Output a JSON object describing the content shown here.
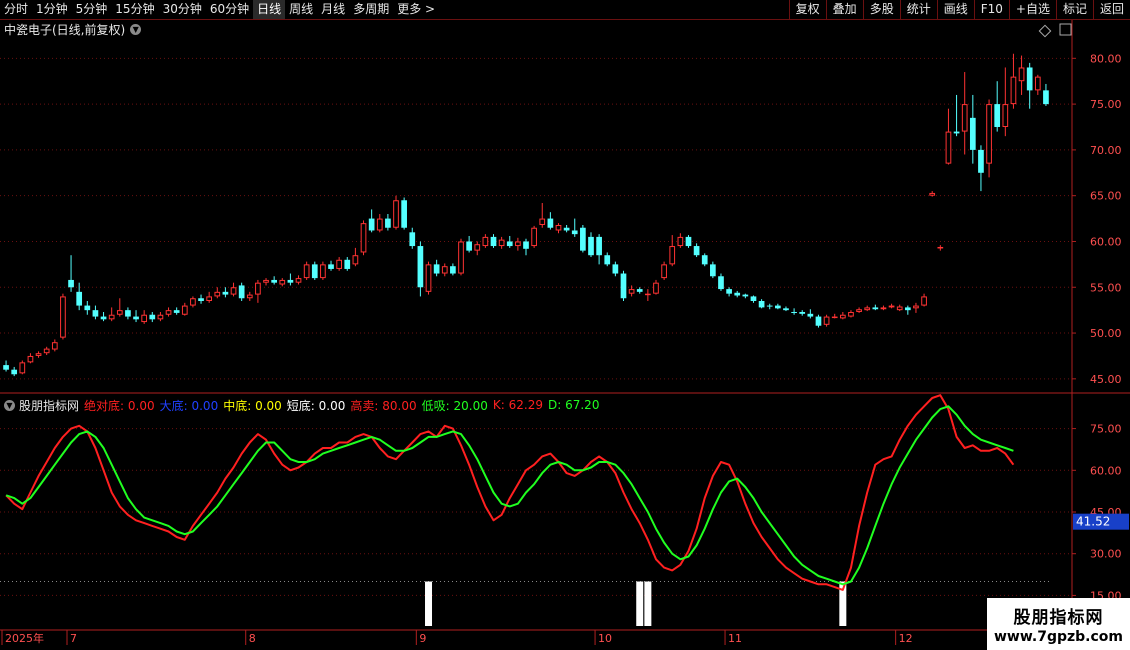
{
  "toolbar": {
    "tabs": [
      "分时",
      "1分钟",
      "5分钟",
      "15分钟",
      "30分钟",
      "60分钟",
      "日线",
      "周线",
      "月线",
      "多周期",
      "更多 >"
    ],
    "active_tab": "日线",
    "right_buttons": [
      "复权",
      "叠加",
      "多股",
      "统计",
      "画线",
      "F10",
      "+自选",
      "标记",
      "返回"
    ]
  },
  "title": "中瓷电子(日线,前复权)",
  "indicator": {
    "name": "股朋指标网",
    "legend": [
      {
        "label": "绝对底:",
        "value": "0.00",
        "color": "#ff2020"
      },
      {
        "label": "大底:",
        "value": "0.00",
        "color": "#2040ff"
      },
      {
        "label": "中底:",
        "value": "0.00",
        "color": "#ffff00"
      },
      {
        "label": "短底:",
        "value": "0.00",
        "color": "#ffffff"
      },
      {
        "label": "高卖:",
        "value": "80.00",
        "color": "#ff2020"
      },
      {
        "label": "低吸:",
        "value": "20.00",
        "color": "#20ff20"
      },
      {
        "label": "K:",
        "value": "62.29",
        "color": "#ff2020"
      },
      {
        "label": "D:",
        "value": "67.20",
        "color": "#20ff20"
      }
    ],
    "current_value": "41.52"
  },
  "watermark": {
    "line1": "股朋指标网",
    "line2": "www.7gpzb.com"
  },
  "colors": {
    "up": "#ff3333",
    "down": "#54ffff",
    "k_line": "#ff2020",
    "d_line": "#20ff20",
    "axis": "#b02020",
    "grid": "#6a1010"
  },
  "chart_data": [
    {
      "type": "candlestick",
      "title": "中瓷电子(日线,前复权)",
      "ylim": [
        44,
        82
      ],
      "y_ticks": [
        45.0,
        50.0,
        55.0,
        60.0,
        65.0,
        70.0,
        75.0,
        80.0
      ],
      "x_ticks": [
        {
          "label": "2025年",
          "index": 0
        },
        {
          "label": "7",
          "index": 8
        },
        {
          "label": "8",
          "index": 30
        },
        {
          "label": "9",
          "index": 51
        },
        {
          "label": "10",
          "index": 73
        },
        {
          "label": "11",
          "index": 89
        },
        {
          "label": "12",
          "index": 110
        }
      ],
      "candles": [
        [
          46.5,
          46.0,
          47.0,
          45.8
        ],
        [
          46.0,
          45.5,
          46.3,
          45.3
        ],
        [
          45.6,
          46.8,
          47.0,
          45.5
        ],
        [
          46.8,
          47.5,
          47.8,
          46.7
        ],
        [
          47.5,
          47.8,
          48.0,
          47.3
        ],
        [
          47.8,
          48.3,
          48.5,
          47.6
        ],
        [
          48.2,
          49.0,
          49.3,
          48.0
        ],
        [
          49.5,
          54.0,
          54.3,
          49.3
        ],
        [
          55.8,
          55.0,
          58.5,
          54.5
        ],
        [
          54.5,
          53.0,
          55.5,
          52.5
        ],
        [
          53.0,
          52.5,
          53.5,
          52.0
        ],
        [
          52.5,
          51.8,
          53.0,
          51.5
        ],
        [
          51.8,
          51.5,
          52.3,
          51.3
        ],
        [
          51.5,
          52.0,
          52.8,
          51.3
        ],
        [
          52.0,
          52.5,
          53.8,
          51.8
        ],
        [
          52.5,
          51.8,
          52.8,
          51.5
        ],
        [
          51.8,
          51.5,
          52.5,
          51.2
        ],
        [
          51.2,
          52.0,
          52.5,
          51.0
        ],
        [
          52.0,
          51.5,
          52.3,
          51.2
        ],
        [
          51.5,
          52.0,
          52.3,
          51.3
        ],
        [
          52.0,
          52.5,
          52.8,
          51.8
        ],
        [
          52.5,
          52.2,
          52.8,
          52.0
        ],
        [
          52.0,
          53.0,
          53.3,
          51.9
        ],
        [
          53.0,
          53.8,
          54.0,
          52.8
        ],
        [
          53.8,
          53.5,
          54.2,
          53.2
        ],
        [
          53.5,
          54.0,
          54.5,
          53.3
        ],
        [
          54.0,
          54.5,
          55.0,
          53.8
        ],
        [
          54.5,
          54.2,
          55.0,
          53.9
        ],
        [
          54.2,
          55.0,
          55.5,
          54.0
        ],
        [
          55.2,
          53.8,
          55.5,
          53.5
        ],
        [
          53.8,
          54.2,
          54.5,
          53.5
        ],
        [
          54.2,
          55.5,
          55.8,
          53.3
        ],
        [
          55.5,
          55.8,
          56.0,
          55.2
        ],
        [
          55.8,
          55.5,
          56.2,
          55.3
        ],
        [
          55.3,
          55.8,
          56.0,
          55.1
        ],
        [
          55.8,
          55.5,
          56.5,
          55.2
        ],
        [
          55.5,
          56.0,
          56.3,
          55.3
        ],
        [
          56.0,
          57.5,
          57.8,
          55.8
        ],
        [
          57.5,
          56.0,
          57.8,
          55.8
        ],
        [
          56.0,
          57.5,
          57.8,
          55.8
        ],
        [
          57.5,
          57.0,
          57.9,
          56.8
        ],
        [
          57.0,
          58.0,
          58.3,
          56.8
        ],
        [
          58.0,
          57.0,
          58.3,
          56.8
        ],
        [
          57.5,
          58.5,
          59.3,
          57.3
        ],
        [
          58.8,
          62.0,
          62.3,
          58.5
        ],
        [
          62.5,
          61.2,
          63.5,
          61.0
        ],
        [
          61.2,
          62.5,
          63.0,
          61.0
        ],
        [
          62.5,
          61.5,
          63.0,
          61.2
        ],
        [
          61.5,
          64.5,
          65.0,
          61.3
        ],
        [
          64.5,
          61.5,
          64.8,
          61.3
        ],
        [
          61.0,
          59.5,
          61.5,
          59.2
        ],
        [
          59.5,
          55.0,
          60.0,
          54.0
        ],
        [
          54.5,
          57.5,
          57.8,
          54.2
        ],
        [
          57.5,
          56.5,
          58.0,
          56.2
        ],
        [
          56.5,
          57.3,
          57.6,
          56.2
        ],
        [
          57.3,
          56.5,
          57.6,
          56.3
        ],
        [
          56.5,
          60.0,
          60.3,
          56.3
        ],
        [
          60.0,
          59.0,
          60.6,
          58.8
        ],
        [
          59.0,
          59.7,
          60.0,
          58.5
        ],
        [
          59.5,
          60.5,
          60.8,
          59.3
        ],
        [
          60.5,
          59.5,
          60.8,
          59.3
        ],
        [
          59.5,
          60.2,
          60.5,
          59.2
        ],
        [
          60.0,
          59.5,
          60.6,
          59.3
        ],
        [
          59.5,
          60.0,
          60.4,
          59.0
        ],
        [
          60.0,
          59.2,
          60.3,
          58.5
        ],
        [
          59.5,
          61.5,
          61.7,
          59.3
        ],
        [
          61.8,
          62.5,
          64.2,
          61.5
        ],
        [
          62.5,
          61.5,
          63.2,
          61.3
        ],
        [
          61.2,
          61.8,
          62.0,
          60.9
        ],
        [
          61.5,
          61.2,
          61.8,
          61.0
        ],
        [
          61.2,
          60.8,
          62.5,
          60.5
        ],
        [
          61.5,
          59.0,
          61.8,
          58.8
        ],
        [
          60.5,
          58.5,
          61.0,
          58.3
        ],
        [
          60.5,
          58.5,
          60.8,
          57.5
        ],
        [
          58.5,
          57.5,
          58.8,
          57.3
        ],
        [
          57.5,
          56.5,
          57.8,
          56.2
        ],
        [
          56.5,
          53.8,
          56.8,
          53.5
        ],
        [
          54.3,
          54.8,
          55.2,
          54.0
        ],
        [
          54.8,
          54.5,
          55.0,
          54.3
        ],
        [
          54.3,
          54.3,
          54.8,
          53.5
        ],
        [
          54.3,
          55.5,
          55.8,
          54.2
        ],
        [
          56.0,
          57.5,
          57.8,
          55.8
        ],
        [
          57.5,
          59.5,
          60.7,
          57.3
        ],
        [
          59.5,
          60.5,
          60.9,
          59.3
        ],
        [
          60.5,
          59.5,
          60.7,
          59.3
        ],
        [
          59.5,
          58.5,
          59.8,
          58.3
        ],
        [
          58.5,
          57.5,
          58.7,
          57.3
        ],
        [
          57.5,
          56.2,
          57.8,
          56.0
        ],
        [
          56.2,
          54.8,
          56.5,
          54.6
        ],
        [
          54.8,
          54.3,
          55.0,
          54.0
        ],
        [
          54.4,
          54.1,
          54.6,
          53.9
        ],
        [
          54.2,
          54.0,
          54.3,
          53.8
        ],
        [
          54.0,
          53.5,
          54.1,
          53.3
        ],
        [
          53.5,
          52.8,
          53.7,
          52.7
        ],
        [
          53.0,
          52.9,
          53.2,
          52.6
        ],
        [
          53.0,
          52.7,
          53.2,
          52.6
        ],
        [
          52.7,
          52.5,
          52.9,
          52.4
        ],
        [
          52.3,
          52.2,
          52.7,
          52.0
        ],
        [
          52.3,
          52.1,
          52.5,
          51.9
        ],
        [
          52.1,
          51.8,
          52.6,
          51.6
        ],
        [
          51.8,
          50.8,
          52.0,
          50.6
        ],
        [
          50.9,
          51.8,
          52.0,
          50.7
        ],
        [
          51.7,
          51.8,
          52.1,
          51.6
        ],
        [
          51.6,
          52.0,
          52.3,
          51.5
        ],
        [
          51.8,
          52.3,
          52.5,
          51.7
        ],
        [
          52.3,
          52.6,
          52.8,
          52.2
        ],
        [
          52.5,
          52.8,
          53.0,
          52.4
        ],
        [
          52.8,
          52.6,
          53.1,
          52.5
        ],
        [
          52.6,
          52.8,
          53.0,
          52.5
        ],
        [
          52.8,
          53.0,
          53.2,
          52.7
        ],
        [
          52.5,
          52.9,
          53.1,
          52.4
        ],
        [
          52.8,
          52.5,
          53.0,
          52.0
        ],
        [
          52.7,
          53.0,
          53.3,
          52.2
        ],
        [
          53.0,
          54.0,
          54.3,
          52.9
        ],
        [
          65.0,
          65.3,
          65.5,
          64.9
        ],
        [
          59.3,
          59.4,
          59.6,
          59.0
        ],
        [
          68.5,
          72.0,
          74.5,
          68.4
        ],
        [
          72.0,
          71.8,
          76.0,
          71.5
        ],
        [
          72.0,
          75.0,
          78.5,
          69.5
        ],
        [
          73.5,
          70.0,
          76.0,
          68.5
        ],
        [
          70.0,
          67.5,
          70.5,
          65.5
        ],
        [
          68.5,
          75.0,
          75.5,
          67.0
        ],
        [
          75.0,
          72.5,
          77.5,
          72.0
        ],
        [
          72.5,
          75.0,
          79.0,
          71.5
        ],
        [
          75.0,
          78.0,
          80.5,
          74.5
        ],
        [
          77.5,
          79.0,
          80.3,
          76.0
        ],
        [
          79.0,
          76.5,
          79.5,
          74.5
        ],
        [
          76.5,
          78.0,
          78.2,
          76.0
        ],
        [
          76.5,
          75.0,
          77.2,
          74.8
        ]
      ]
    },
    {
      "type": "line",
      "title": "股朋指标网",
      "ylim": [
        4,
        86
      ],
      "y_ticks": [
        15.0,
        30.0,
        45.0,
        60.0,
        75.0
      ],
      "reference_lines": {
        "high_sell": 80.0,
        "low_buy": 20.0
      },
      "series": [
        {
          "name": "K",
          "values": [
            51,
            48,
            46,
            52,
            58,
            63,
            68,
            72,
            75,
            76,
            74,
            68,
            60,
            52,
            47,
            44,
            42,
            41,
            40,
            39,
            38,
            36,
            35,
            40,
            44,
            48,
            52,
            57,
            61,
            66,
            70,
            73,
            71,
            66,
            62,
            60,
            61,
            63,
            66,
            68,
            68,
            70,
            70,
            72,
            73,
            72,
            68,
            65,
            64,
            67,
            70,
            73,
            74,
            72,
            76,
            75,
            69,
            62,
            54,
            47,
            42,
            44,
            50,
            55,
            60,
            62,
            65,
            66,
            63,
            59,
            58,
            60,
            63,
            65,
            63,
            59,
            52,
            46,
            41,
            35,
            28,
            25,
            24,
            26,
            31,
            39,
            50,
            58,
            63,
            62,
            56,
            48,
            41,
            36,
            32,
            28,
            25,
            23,
            21,
            20,
            19,
            19,
            18,
            17,
            25,
            40,
            52,
            62,
            64,
            65,
            71,
            76,
            80,
            83,
            86,
            87,
            82,
            72,
            68,
            69,
            67,
            67,
            68,
            66,
            62
          ]
        },
        {
          "name": "D",
          "values": [
            51,
            50,
            48,
            50,
            54,
            58,
            62,
            66,
            70,
            73,
            74,
            72,
            68,
            62,
            56,
            50,
            46,
            43,
            42,
            41,
            40,
            38,
            37,
            38,
            41,
            44,
            47,
            51,
            55,
            59,
            63,
            67,
            70,
            70,
            67,
            64,
            63,
            63,
            64,
            66,
            67,
            68,
            69,
            70,
            71,
            72,
            71,
            69,
            67,
            67,
            68,
            70,
            72,
            72,
            73,
            74,
            73,
            69,
            64,
            58,
            52,
            48,
            47,
            48,
            52,
            55,
            59,
            62,
            63,
            62,
            60,
            60,
            61,
            63,
            63,
            62,
            59,
            55,
            50,
            45,
            39,
            34,
            30,
            28,
            29,
            33,
            39,
            46,
            52,
            56,
            57,
            54,
            50,
            45,
            41,
            37,
            33,
            29,
            26,
            24,
            22,
            21,
            20,
            19,
            20,
            25,
            32,
            40,
            48,
            55,
            61,
            66,
            71,
            75,
            79,
            82,
            83,
            80,
            76,
            73,
            71,
            70,
            69,
            68,
            67
          ]
        },
        {
          "name": "signal",
          "values": [
            0,
            0,
            0,
            0,
            0,
            0,
            0,
            0,
            0,
            0,
            0,
            0,
            0,
            0,
            0,
            0,
            0,
            0,
            0,
            0,
            0,
            0,
            0,
            0,
            0,
            0,
            0,
            0,
            0,
            0,
            0,
            0,
            0,
            0,
            0,
            0,
            0,
            0,
            0,
            0,
            0,
            0,
            0,
            0,
            0,
            0,
            0,
            0,
            0,
            0,
            0,
            0,
            1,
            0,
            0,
            0,
            0,
            0,
            0,
            0,
            0,
            0,
            0,
            0,
            0,
            0,
            0,
            0,
            0,
            0,
            0,
            0,
            0,
            0,
            0,
            0,
            0,
            0,
            1,
            1,
            0,
            0,
            0,
            0,
            0,
            0,
            0,
            0,
            0,
            0,
            0,
            0,
            0,
            0,
            0,
            0,
            0,
            0,
            0,
            0,
            0,
            0,
            0,
            1,
            0,
            0,
            0,
            0,
            0,
            0,
            0,
            0,
            0,
            0,
            0,
            0,
            0,
            0,
            0,
            0,
            0,
            0,
            0,
            0,
            0
          ]
        }
      ]
    }
  ]
}
